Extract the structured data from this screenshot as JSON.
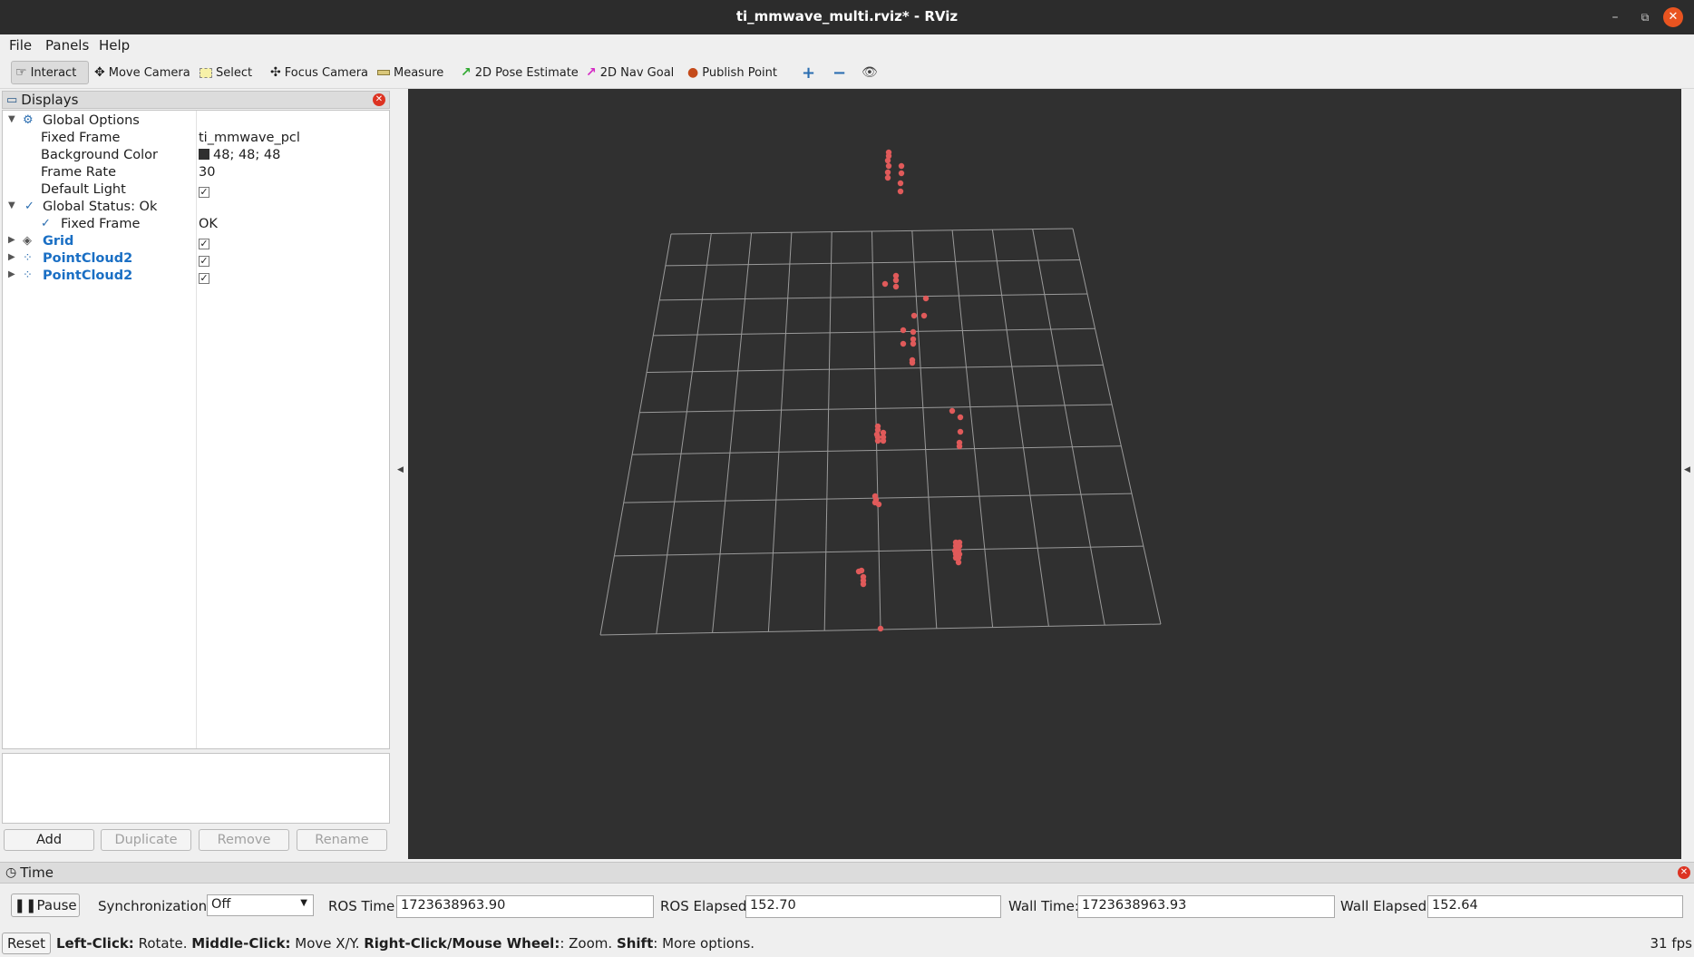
{
  "window": {
    "title": "ti_mmwave_multi.rviz* - RViz"
  },
  "menu": {
    "file": "File",
    "panels": "Panels",
    "help": "Help"
  },
  "toolbar": {
    "interact": "Interact",
    "move_camera": "Move Camera",
    "select": "Select",
    "focus_camera": "Focus Camera",
    "measure": "Measure",
    "pose_estimate": "2D Pose Estimate",
    "nav_goal": "2D Nav Goal",
    "publish_point": "Publish Point"
  },
  "displays": {
    "title": "Displays",
    "global_options": "Global Options",
    "fixed_frame_label": "Fixed Frame",
    "fixed_frame_value": "ti_mmwave_pcl",
    "background_color_label": "Background Color",
    "background_color_value": "48; 48; 48",
    "frame_rate_label": "Frame Rate",
    "frame_rate_value": "30",
    "default_light_label": "Default Light",
    "global_status": "Global Status: Ok",
    "status_fixed_frame_label": "Fixed Frame",
    "status_fixed_frame_value": "OK",
    "grid": "Grid",
    "pointcloud_a": "PointCloud2",
    "pointcloud_b": "PointCloud2",
    "add": "Add",
    "duplicate": "Duplicate",
    "remove": "Remove",
    "rename": "Rename"
  },
  "time": {
    "title": "Time",
    "pause": "Pause",
    "sync_label": "Synchronization:",
    "sync_value": "Off",
    "ros_time_label": "ROS Time:",
    "ros_time_value": "1723638963.90",
    "ros_elapsed_label": "ROS Elapsed:",
    "ros_elapsed_value": "152.70",
    "wall_time_label": "Wall Time:",
    "wall_time_value": "1723638963.93",
    "wall_elapsed_label": "Wall Elapsed:",
    "wall_elapsed_value": "152.64"
  },
  "status": {
    "reset": "Reset",
    "left_click_key": "Left-Click:",
    "left_click_desc": " Rotate. ",
    "middle_click_key": "Middle-Click:",
    "middle_click_desc": " Move X/Y. ",
    "right_click_key": "Right-Click/Mouse Wheel:",
    "right_click_desc": ": Zoom. ",
    "shift_key": "Shift",
    "shift_desc": ": More options.",
    "fps": "31 fps"
  },
  "colors": {
    "background": "#303030",
    "points": "#e05a5a",
    "grid": "#a0a0a0"
  }
}
